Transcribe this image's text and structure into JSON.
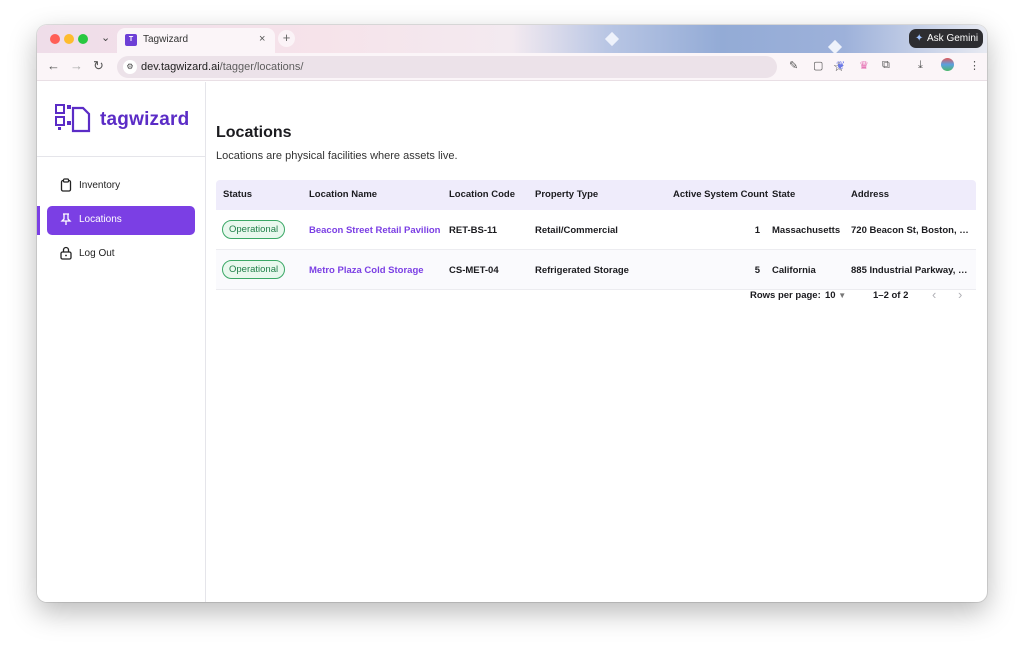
{
  "browser": {
    "tab_title": "Tagwizard",
    "url_host": "dev.tagwizard.ai",
    "url_path": "/tagger/locations/",
    "gemini_label": "Ask Gemini"
  },
  "sidebar": {
    "logo_text": "tagwizard",
    "items": [
      {
        "label": "Inventory"
      },
      {
        "label": "Locations"
      },
      {
        "label": "Log Out"
      }
    ]
  },
  "main": {
    "title": "Locations",
    "subtitle": "Locations are physical facilities where assets live.",
    "columns": [
      "Status",
      "Location Name",
      "Location Code",
      "Property Type",
      "Active System Count",
      "State",
      "Address"
    ],
    "rows": [
      {
        "status": "Operational",
        "name": "Beacon Street Retail Pavilion",
        "code": "RET-BS-11",
        "property_type": "Retail/Commercial",
        "active_count": "1",
        "state": "Massachusetts",
        "address": "720 Beacon St, Boston, M..."
      },
      {
        "status": "Operational",
        "name": "Metro Plaza Cold Storage",
        "code": "CS-MET-04",
        "property_type": "Refrigerated Storage",
        "active_count": "5",
        "state": "California",
        "address": "885 Industrial Parkway, Lo..."
      }
    ],
    "pagination": {
      "rows_per_page_label": "Rows per page:",
      "rows_per_page_value": "10",
      "range": "1–2 of 2"
    }
  },
  "colors": {
    "brand": "#7b3fe4",
    "status_ok": "#21804a"
  }
}
